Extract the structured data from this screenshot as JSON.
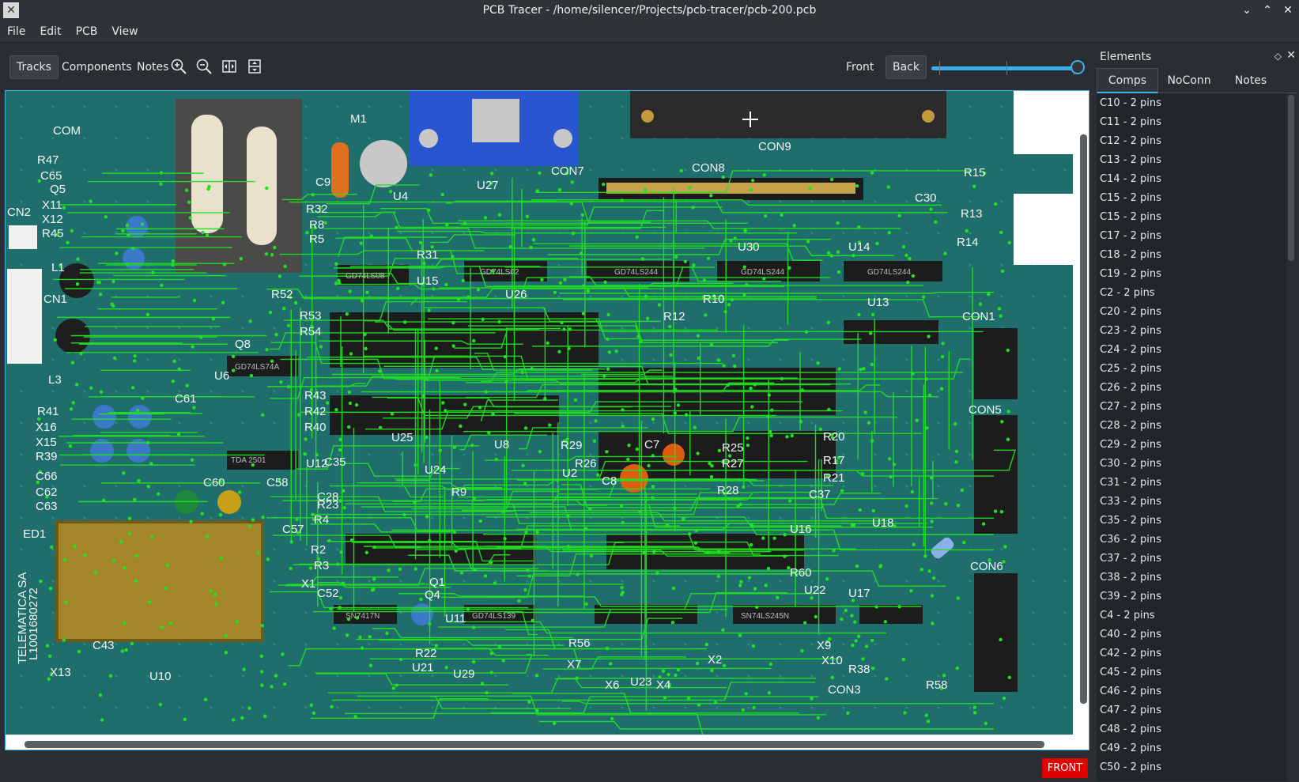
{
  "window": {
    "title": "PCB Tracer - /home/silencer/Projects/pcb-tracer/pcb-200.pcb"
  },
  "menu": [
    "File",
    "Edit",
    "PCB",
    "View"
  ],
  "toolbar": {
    "tracks": "Tracks",
    "components": "Components",
    "notes": "Notes",
    "front": "Front",
    "back": "Back",
    "layer_opacity": 1.0
  },
  "icons": {
    "zoom_in": "zoom-in-icon",
    "zoom_out": "zoom-out-icon",
    "fit_width": "fit-width-icon",
    "fit_height": "fit-height-icon"
  },
  "canvas": {
    "side_badge": "FRONT",
    "board_labels": [
      "COM",
      "R47",
      "C65",
      "Q5",
      "X11",
      "X12",
      "R45",
      "CN2",
      "L1",
      "CN1",
      "L3",
      "R41",
      "X16",
      "X15",
      "R39",
      "C66",
      "C62",
      "C63",
      "ED1",
      "TELEMATICA SA",
      "L1001680272",
      "X13",
      "U10",
      "C43",
      "M1",
      "R32",
      "R8",
      "R5",
      "R31",
      "C9",
      "U27",
      "U4",
      "CON7",
      "CON8",
      "CON9",
      "U15",
      "U26",
      "R52",
      "R53",
      "R54",
      "Q8",
      "U6",
      "C61",
      "C60",
      "C58",
      "C57",
      "R43",
      "R42",
      "R40",
      "R4",
      "R2",
      "R3",
      "X1",
      "Q1",
      "Q4",
      "C52",
      "U11",
      "U29",
      "R22",
      "U21",
      "U23",
      "R29",
      "R26",
      "R25",
      "R27",
      "R28",
      "C8",
      "C7",
      "R10",
      "R12",
      "U30",
      "U14",
      "U13",
      "C30",
      "R15",
      "R13",
      "R14",
      "CON1",
      "CON5",
      "CON6",
      "R20",
      "R21",
      "R17",
      "C37",
      "U16",
      "U18",
      "R60",
      "U22",
      "U17",
      "X7",
      "X6",
      "X4",
      "X2",
      "X9",
      "X10",
      "R38",
      "R58",
      "CON3",
      "R56",
      "U8",
      "U2",
      "U12",
      "C35",
      "C28",
      "R23",
      "U25",
      "U24",
      "R9"
    ],
    "chip_labels": [
      "GD74LS08",
      "GD74LS02",
      "GD74LS244",
      "GD74LS244",
      "GD74LS244",
      "GD74LS74A",
      "GD74LS139",
      "SN7417N",
      "SN74LS245N",
      "TDA 2501"
    ]
  },
  "panel": {
    "title": "Elements",
    "tabs": [
      "Comps",
      "NoConn",
      "Notes"
    ],
    "items": [
      "C10 - 2 pins",
      "C11 - 2 pins",
      "C12 - 2 pins",
      "C13 - 2 pins",
      "C14 - 2 pins",
      "C15 - 2 pins",
      "C15 - 2 pins",
      "C17 - 2 pins",
      "C18 - 2 pins",
      "C19 - 2 pins",
      "C2 - 2 pins",
      "C20 - 2 pins",
      "C23 - 2 pins",
      "C24 - 2 pins",
      "C25 - 2 pins",
      "C26 - 2 pins",
      "C27 - 2 pins",
      "C28 - 2 pins",
      "C29 - 2 pins",
      "C30 - 2 pins",
      "C31 - 2 pins",
      "C33 - 2 pins",
      "C35 - 2 pins",
      "C36 - 2 pins",
      "C37 - 2 pins",
      "C38 - 2 pins",
      "C39 - 2 pins",
      "C4 - 2 pins",
      "C40 - 2 pins",
      "C42 - 2 pins",
      "C45 - 2 pins",
      "C46 - 2 pins",
      "C47 - 2 pins",
      "C48 - 2 pins",
      "C49 - 2 pins",
      "C50 - 2 pins"
    ]
  },
  "colors": {
    "accent": "#3daee9",
    "trace": "#22e022",
    "board": "#1f7070",
    "badge": "#e00000"
  }
}
